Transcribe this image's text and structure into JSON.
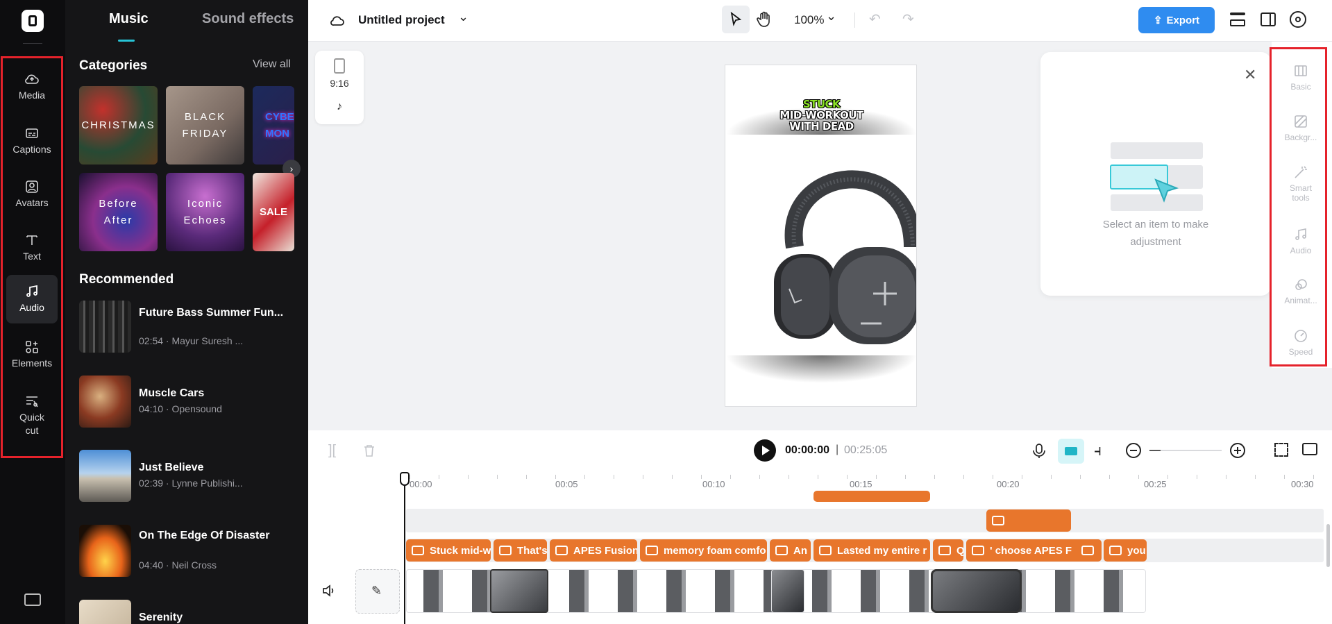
{
  "rail": {
    "items": [
      {
        "label": "Media",
        "icon": "cloud-upload-icon"
      },
      {
        "label": "Captions",
        "icon": "captions-icon"
      },
      {
        "label": "Avatars",
        "icon": "avatar-icon"
      },
      {
        "label": "Text",
        "icon": "text-icon"
      },
      {
        "label": "Audio",
        "icon": "music-note-icon"
      },
      {
        "label": "Elements",
        "icon": "elements-icon"
      },
      {
        "label": "Quick cut",
        "icon": "quick-cut-icon"
      }
    ],
    "active": "Audio"
  },
  "panel": {
    "tabs": [
      "Music",
      "Sound effects"
    ],
    "active_tab": "Music",
    "categories_title": "Categories",
    "view_all": "View all",
    "categories": [
      "CHRISTMAS",
      "BLACK FRIDAY",
      "CYBER MON",
      "Before After",
      "Iconic Echoes",
      "SALE"
    ],
    "recommended_title": "Recommended",
    "tracks": [
      {
        "title": "Future Bass Summer Fun...",
        "meta": "02:54 · Mayur Suresh ..."
      },
      {
        "title": "Muscle Cars",
        "meta": "04:10 · Opensound"
      },
      {
        "title": "Just Believe",
        "meta": "02:39 · Lynne Publishi..."
      },
      {
        "title": "On The Edge Of Disaster",
        "meta": "04:40 · Neil Cross"
      },
      {
        "title": "Serenity",
        "meta": ""
      }
    ]
  },
  "topbar": {
    "project_title": "Untitled project",
    "zoom": "100%",
    "export_label": "Export"
  },
  "stage": {
    "aspect_label": "9:16",
    "caption_line1": "STUCK",
    "caption_line2": "MID-WORKOUT",
    "caption_line3": "WITH DEAD",
    "hint": "Select an item to make adjustment"
  },
  "right_tools": [
    "Basic",
    "Backgr...",
    "Smart tools",
    "Audio",
    "Animat...",
    "Speed"
  ],
  "player": {
    "current": "00:00:00",
    "separator": "|",
    "total": "00:25:05"
  },
  "ruler": [
    "00:00",
    "00:05",
    "00:10",
    "00:15",
    "00:20",
    "00:25",
    "00:30"
  ],
  "caption_clips": [
    "Stuck mid-w",
    "That's",
    "APES Fusion",
    "memory foam comfo",
    "An",
    "Lasted my entire r",
    "Q",
    "' choose APES F",
    "",
    "you"
  ],
  "colors": {
    "accent": "#e8762c",
    "export": "#2f8cf0",
    "highlight": "#e5222b"
  }
}
